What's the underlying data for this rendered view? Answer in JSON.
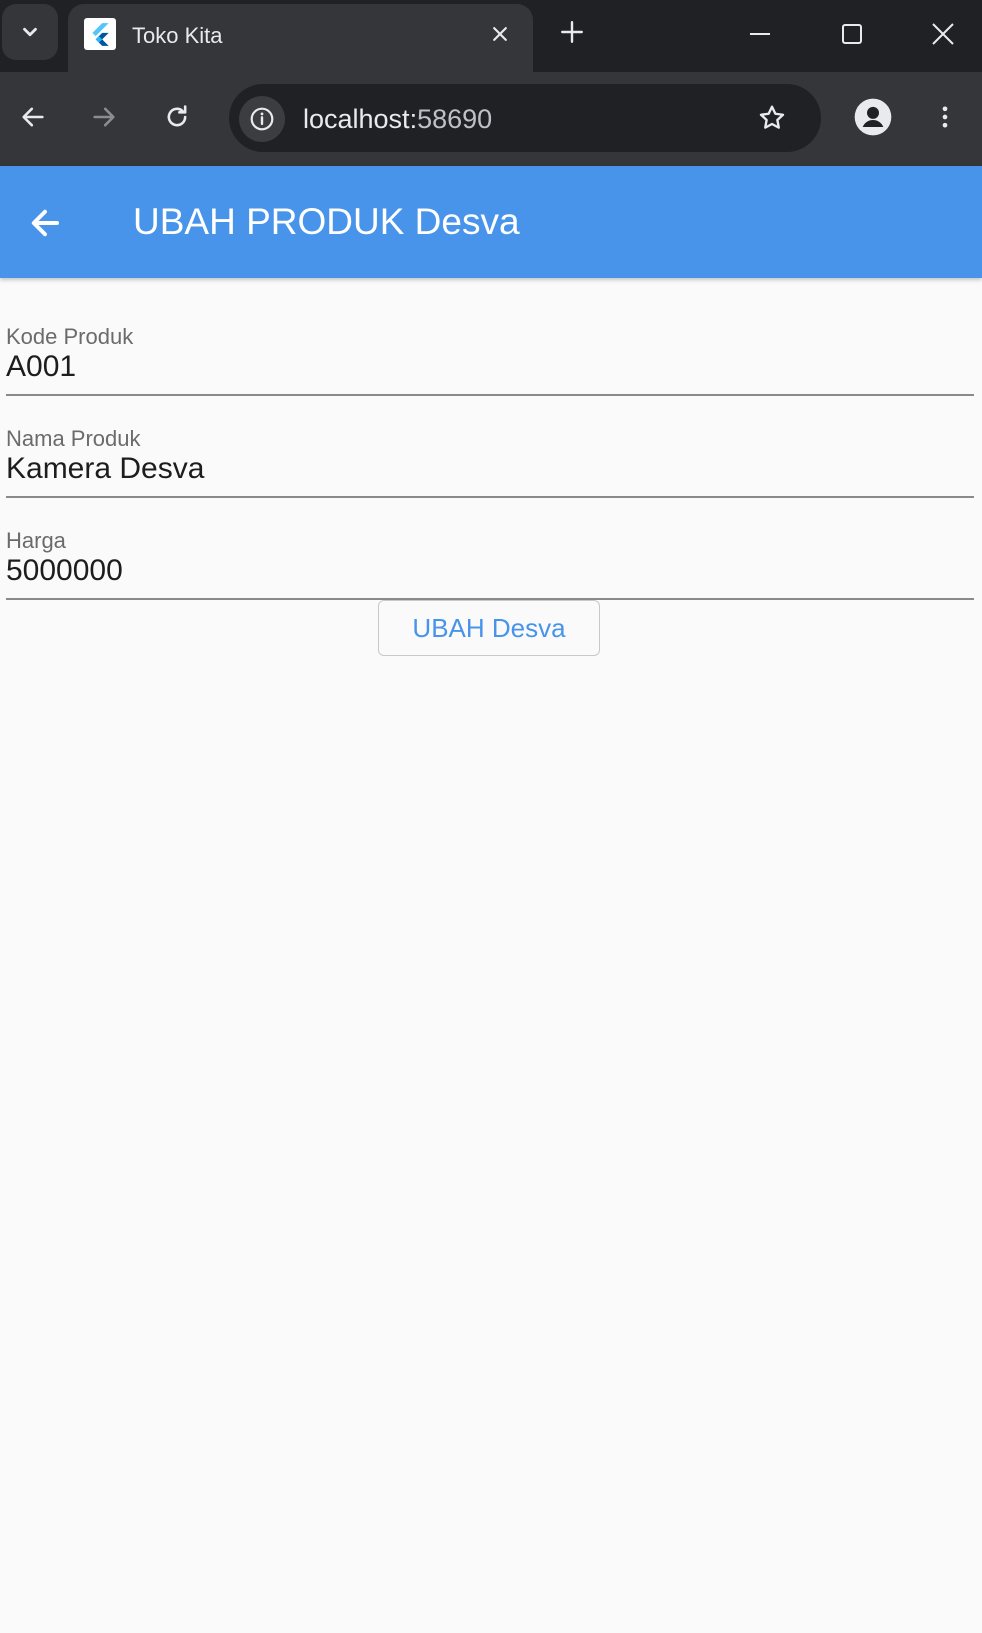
{
  "browser": {
    "tab_title": "Toko Kita",
    "url_host": "localhost:",
    "url_port": "58690"
  },
  "icons": {
    "tab_search": "chevron-down-icon",
    "favicon": "flutter-icon",
    "tab_close": "close-icon",
    "new_tab": "plus-icon",
    "minimize": "minimize-icon",
    "maximize": "maximize-icon",
    "window_close": "close-icon",
    "back": "arrow-left-icon",
    "forward": "arrow-right-icon",
    "reload": "reload-icon",
    "site_info": "info-icon",
    "bookmark": "star-icon",
    "profile": "person-icon",
    "menu": "more-vertical-icon",
    "app_back": "arrow-left-icon"
  },
  "colors": {
    "appbar": "#4894ea",
    "accent": "#4894ea"
  },
  "app": {
    "title": "UBAH PRODUK Desva",
    "fields": [
      {
        "label": "Kode Produk",
        "value": "A001"
      },
      {
        "label": "Nama Produk",
        "value": "Kamera Desva"
      },
      {
        "label": "Harga",
        "value": "5000000"
      }
    ],
    "submit_label": "UBAH Desva"
  }
}
